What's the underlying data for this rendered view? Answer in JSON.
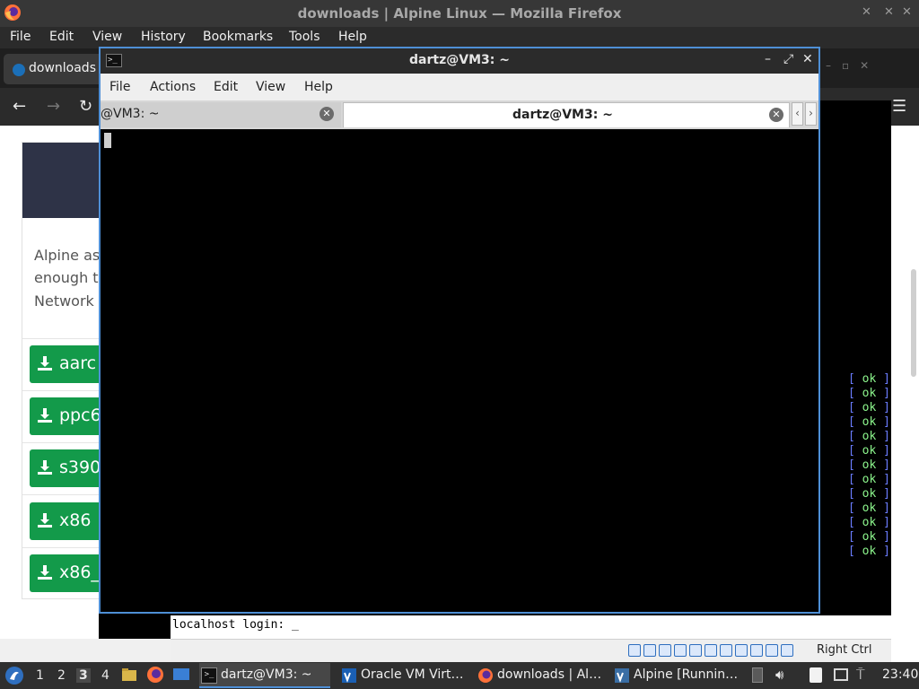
{
  "firefox": {
    "window_title": "downloads | Alpine Linux — Mozilla Firefox",
    "menu": [
      "File",
      "Edit",
      "View",
      "History",
      "Bookmarks",
      "Tools",
      "Help"
    ],
    "tab_label": "downloads |",
    "page": {
      "text_lines": [
        "Alpine as",
        "enough t",
        "Network"
      ],
      "download_buttons": [
        "aarc",
        "ppc6",
        "s390",
        "x86",
        "x86_"
      ]
    }
  },
  "terminal": {
    "window_title": "dartz@VM3: ~",
    "menu": [
      "File",
      "Actions",
      "Edit",
      "View",
      "Help"
    ],
    "tabs": [
      {
        "label": "@VM3: ~"
      },
      {
        "label": "dartz@VM3: ~"
      }
    ]
  },
  "vm_console": {
    "boot_status": "ok",
    "boot_status_count": 13,
    "login_prompt": "localhost login: _",
    "host_key": "Right Ctrl"
  },
  "taskbar": {
    "workspaces": [
      "1",
      "2",
      "3",
      "4"
    ],
    "active_workspace": "3",
    "tasks": [
      {
        "label": "dartz@VM3: ~"
      },
      {
        "label": "Oracle VM Virt…"
      },
      {
        "label": "downloads | Al…"
      },
      {
        "label": "Alpine [Runnin…"
      }
    ],
    "clock": "23:40"
  },
  "colors": {
    "download_green": "#139a4a",
    "terminal_border": "#4e8fd6",
    "ok_green": "#8cf58c",
    "bracket_blue": "#6a7cff"
  }
}
